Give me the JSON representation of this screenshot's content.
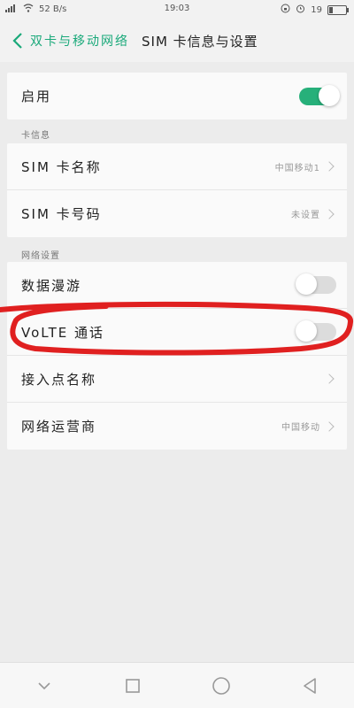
{
  "status_bar": {
    "network_speed": "52 B/s",
    "time": "19:03",
    "battery_percent": "19"
  },
  "header": {
    "back_label": "双卡与移动网络",
    "title": "SIM 卡信息与设置"
  },
  "enable_row": {
    "label": "启用",
    "toggle_on": true
  },
  "card_info": {
    "section_label": "卡信息",
    "sim_name_label": "SIM 卡名称",
    "sim_name_value": "中国移动1",
    "sim_number_label": "SIM 卡号码",
    "sim_number_value": "未设置"
  },
  "network": {
    "section_label": "网络设置",
    "roaming_label": "数据漫游",
    "roaming_on": false,
    "volte_label": "VoLTE 通话",
    "volte_on": false,
    "apn_label": "接入点名称",
    "operator_label": "网络运营商",
    "operator_value": "中国移动"
  },
  "colors": {
    "accent": "#27b07a",
    "annotation": "#e02020"
  },
  "icons": {
    "back": "chevron-left-icon",
    "nav_back": "triangle-back-icon",
    "nav_home": "circle-home-icon",
    "nav_recents": "square-recents-icon",
    "nav_hide": "chevron-down-icon"
  }
}
